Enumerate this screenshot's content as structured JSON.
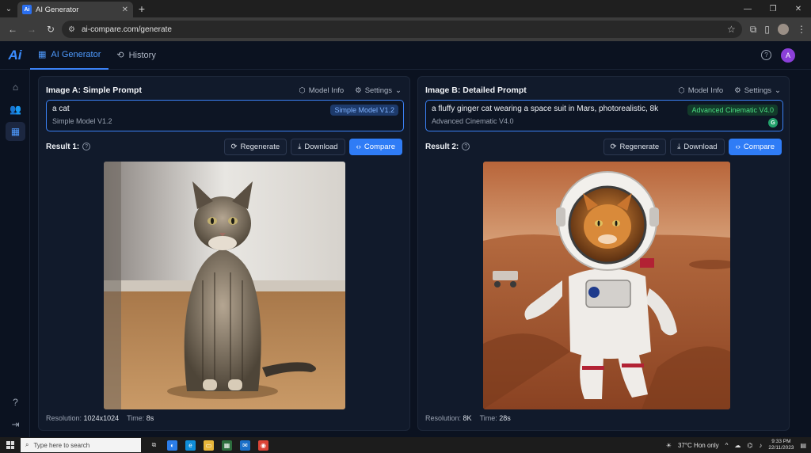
{
  "browser": {
    "tab_title": "AI Generator",
    "favicon_text": "Ai",
    "url": "ai-compare.com/generate"
  },
  "app": {
    "logo": "Ai",
    "nav": [
      {
        "label": "AI Generator",
        "icon": "grid-icon",
        "active": true
      },
      {
        "label": "History",
        "icon": "history-icon",
        "active": false
      }
    ],
    "avatar_initial": "A"
  },
  "panels": {
    "a": {
      "title": "Image A: Simple Prompt",
      "model_info": "Model Info",
      "settings": "Settings",
      "prompt": "a cat",
      "model_sub": "Simple Model V1.2",
      "model_badge": "Simple Model V1.2",
      "result_label": "Result 1:",
      "regenerate": "Regenerate",
      "download": "Download",
      "compare": "Compare",
      "resolution_label": "Resolution:",
      "resolution": "1024x1024",
      "time_label": "Time:",
      "time": "8s"
    },
    "b": {
      "title": "Image B: Detailed Prompt",
      "model_info": "Model Info",
      "settings": "Settings",
      "prompt": "a fluffy ginger cat wearing a space suit in Mars, photorealistic, 8k",
      "model_sub": "Advanced Cinematic V4.0",
      "model_badge": "Advanced Cinematic V4.0",
      "g_badge": "G",
      "result_label": "Result 2:",
      "regenerate": "Regenerate",
      "download": "Download",
      "compare": "Compare",
      "resolution_label": "Resolution:",
      "resolution": "8K",
      "time_label": "Time:",
      "time": "28s"
    }
  },
  "taskbar": {
    "search_placeholder": "Type here to search",
    "weather": "37°C Hon only",
    "time": "9:33 PM",
    "date": "22/11/2023"
  },
  "colors": {
    "accent": "#3b82f6",
    "background": "#0b1220",
    "panel": "#111a2b",
    "badge_green": "#4ade80"
  }
}
